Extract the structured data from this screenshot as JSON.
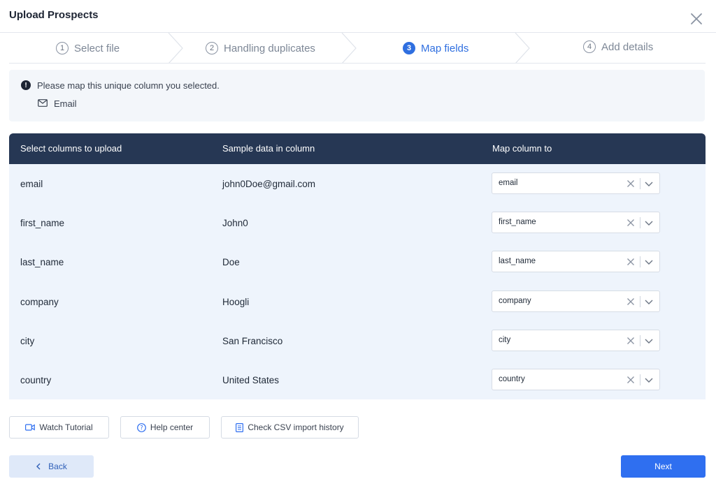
{
  "modal": {
    "title": "Upload Prospects",
    "close_icon": "close-icon"
  },
  "steps": [
    {
      "number": "1",
      "label": "Select file",
      "state": "done"
    },
    {
      "number": "2",
      "label": "Handling duplicates",
      "state": "done"
    },
    {
      "number": "3",
      "label": "Map fields",
      "state": "active"
    },
    {
      "number": "4",
      "label": "Add details",
      "state": "upcoming"
    }
  ],
  "notice": {
    "icon": "alert-circle-icon",
    "message": "Please map this unique column you selected.",
    "column_icon": "mail-icon",
    "column": "Email"
  },
  "table": {
    "headers": {
      "select": "Select columns to upload",
      "sample": "Sample data in column",
      "map": "Map column to"
    },
    "rows": [
      {
        "column": "email",
        "sample": "john0Doe@gmail.com",
        "mapped": "email"
      },
      {
        "column": "first_name",
        "sample": "John0",
        "mapped": "first_name"
      },
      {
        "column": "last_name",
        "sample": "Doe",
        "mapped": "last_name"
      },
      {
        "column": "company",
        "sample": "Hoogli",
        "mapped": "company"
      },
      {
        "column": "city",
        "sample": "San Francisco",
        "mapped": "city"
      },
      {
        "column": "country",
        "sample": "United States",
        "mapped": "country"
      }
    ]
  },
  "utility_buttons": {
    "watch_tutorial": "Watch Tutorial",
    "help_center": "Help center",
    "csv_history": "Check CSV import history"
  },
  "footer": {
    "back": "Back",
    "next": "Next"
  },
  "colors": {
    "accent": "#2f6ff0",
    "header_bg": "#263754",
    "table_bg": "#eef4fc"
  }
}
